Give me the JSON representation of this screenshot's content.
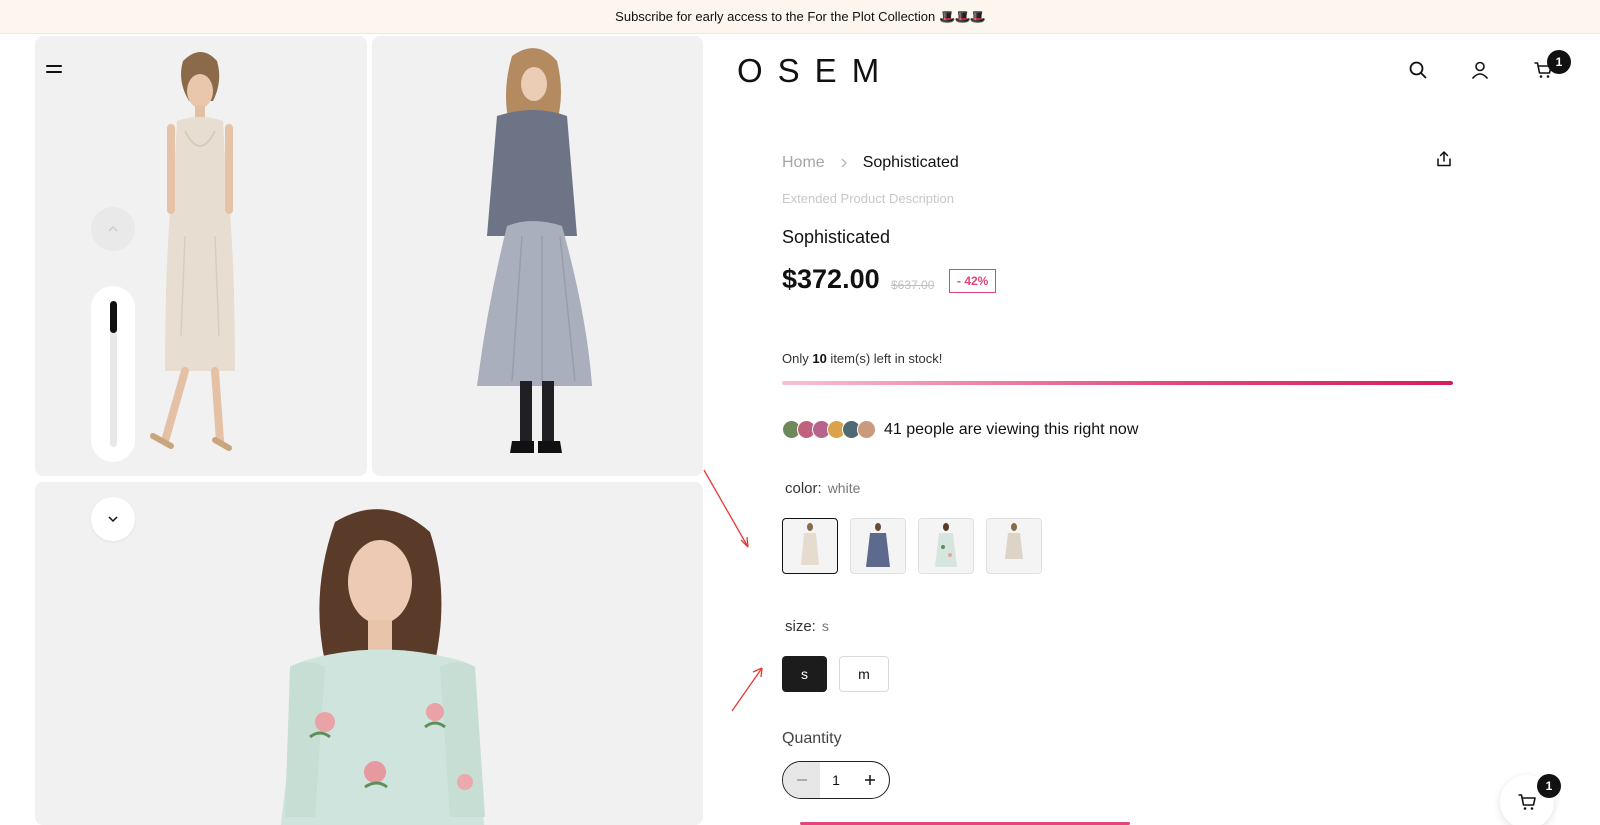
{
  "announcement": {
    "text": "Subscribe for early access to the For the Plot Collection",
    "emoji": "🎩🎩🎩"
  },
  "header": {
    "logo": "OSEM",
    "menu_icon": "hamburger-icon",
    "icons": [
      "search-icon",
      "account-icon",
      "cart-icon"
    ],
    "cart_count": "1"
  },
  "gallery": {
    "images": [
      "model-in-champagne-slip-dress",
      "model-in-grey-jacket-and-skirt",
      "model-in-floral-cold-shoulder-dress"
    ],
    "nav_up_icon": "chevron-up-icon",
    "nav_down_icon": "chevron-down-icon",
    "scroll_position": 0.0
  },
  "breadcrumb": {
    "home": "Home",
    "current": "Sophisticated"
  },
  "product": {
    "extended_description": "Extended Product Description",
    "title": "Sophisticated",
    "price": "$372.00",
    "old_price": "$637.00",
    "discount": "- 42%",
    "stock_prefix": "Only ",
    "stock_count": "10",
    "stock_suffix": " item(s) left in stock!",
    "stock_progress": 1.0,
    "viewers_text": "41 people are viewing this right now",
    "color_label": "color:",
    "color_value": "white",
    "size_label": "size:",
    "size_value": "s",
    "sizes": [
      "s",
      "m"
    ],
    "quantity_label": "Quantity",
    "quantity_value": "1"
  },
  "colors": {
    "accent": "#e2457b",
    "dark": "#1c1c1c",
    "announce_bg": "#fdf6ee"
  },
  "floating_cart": {
    "count": "1"
  }
}
